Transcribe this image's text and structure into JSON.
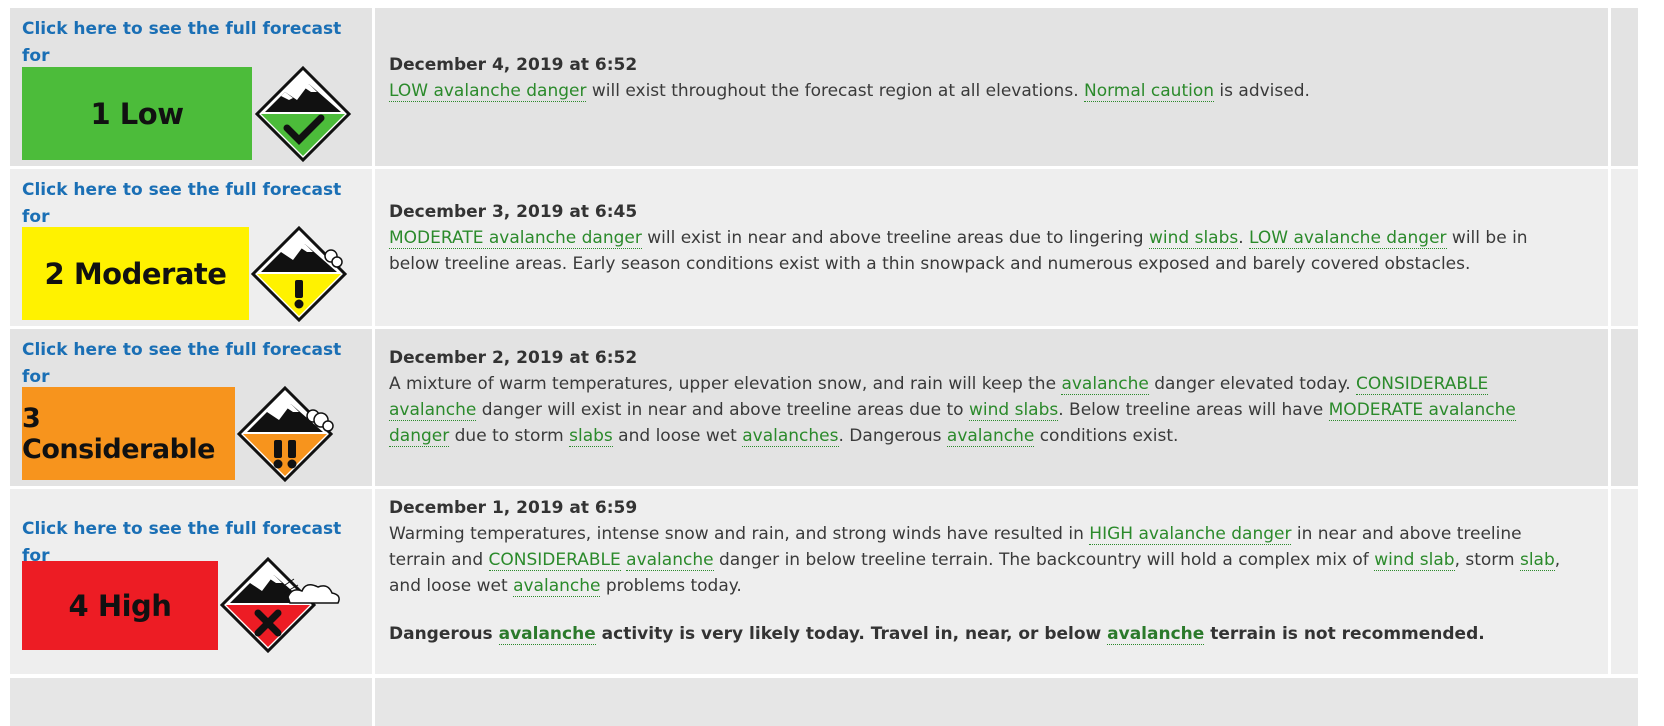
{
  "rows": [
    {
      "link_line1": "Click here to see the full forecast for",
      "link_line2": "2019-12-04",
      "danger_label": "1 Low",
      "danger_color": "#4cbc3a",
      "date": "December 4, 2019 at 6:52",
      "desc": {
        "t1": "LOW avalanche danger",
        "t2": " will exist throughout the forecast region at all elevations.  ",
        "t3": "Normal caution",
        "t4": " is advised."
      }
    },
    {
      "link_line1": "Click here to see the full forecast for",
      "link_line2": "2019-12-03",
      "danger_label": "2 Moderate",
      "danger_color": "#fff200",
      "date": "December 3, 2019 at 6:45",
      "desc": {
        "t1": "MODERATE avalanche danger",
        "t2": " will exist in near and above treeline areas due to lingering ",
        "t3": "wind slabs",
        "t4": ".  ",
        "t5": "LOW avalanche danger",
        "t6": " will be in below treeline areas.  Early season conditions exist with a thin snowpack and numerous exposed and barely covered obstacles."
      }
    },
    {
      "link_line1": "Click here to see the full forecast for",
      "link_line2": "2019-12-02",
      "danger_label": "3 Considerable",
      "danger_color": "#f7941d",
      "date": "December 2, 2019 at 6:52",
      "desc": {
        "t1": "A mixture of warm temperatures, upper elevation snow, and rain will keep the ",
        "t2": "avalanche",
        "t3": " danger elevated today.  ",
        "t4": "CONSIDERABLE",
        "t5": " ",
        "t6": "avalanche",
        "t7": " danger will exist in near and above treeline areas due to ",
        "t8": "wind slabs",
        "t9": ".  Below treeline areas will have ",
        "t10": "MODERATE avalanche danger",
        "t11": " due to storm ",
        "t12": "slabs",
        "t13": " and loose wet ",
        "t14": "avalanches",
        "t15": ".  Dangerous ",
        "t16": "avalanche",
        "t17": " conditions exist."
      }
    },
    {
      "link_line1": "Click here to see the full forecast for",
      "link_line2": "2019-12-01",
      "danger_label": "4 High",
      "danger_color": "#ed1c24",
      "date": "December 1, 2019 at 6:59",
      "desc": {
        "t1": "Warming temperatures, intense snow and rain, and strong winds have resulted in ",
        "t2": "HIGH avalanche danger",
        "t3": " in near and above treeline terrain and ",
        "t4": "CONSIDERABLE",
        "t5": " ",
        "t6": "avalanche",
        "t7": " danger in below treeline terrain. The backcountry will hold a complex mix of ",
        "t8": "wind slab",
        "t9": ", storm ",
        "t10": "slab",
        "t11": ", and loose wet ",
        "t12": "avalanche",
        "t13": " problems today."
      },
      "note": {
        "n1": "Dangerous ",
        "n2": "avalanche",
        "n3": " activity is very likely today. Travel in, near, or below ",
        "n4": "avalanche",
        "n5": " terrain is not recommended."
      }
    }
  ],
  "icons": {
    "low": "mountain-check-icon",
    "moderate": "mountain-exclamation-icon",
    "considerable": "mountain-double-exclamation-icon",
    "high": "mountain-x-icon"
  },
  "colors": {
    "link": "#1a6fb5",
    "glossary_link": "#2b8a2b"
  }
}
